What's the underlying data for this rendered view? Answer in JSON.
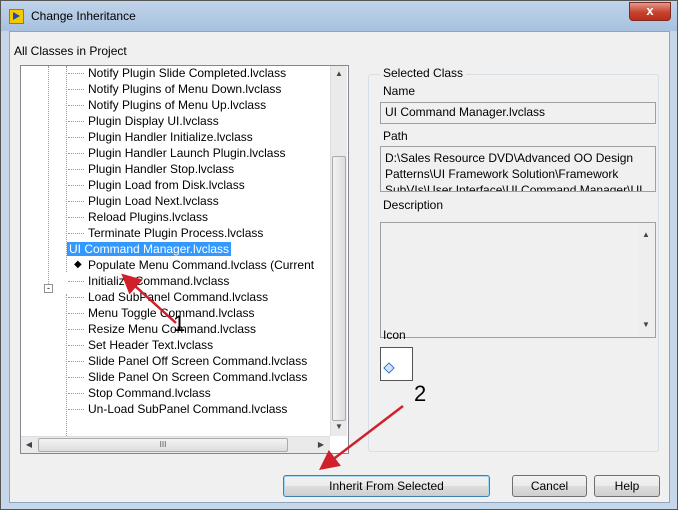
{
  "window": {
    "title": "Change Inheritance",
    "close_label": "x"
  },
  "tree": {
    "label": "All Classes in Project",
    "items": [
      "Notify Plugin Slide Completed.lvclass",
      "Notify Plugins of Menu Down.lvclass",
      "Notify Plugins of Menu Up.lvclass",
      "Plugin Display UI.lvclass",
      "Plugin Handler Initialize.lvclass",
      "Plugin Handler Launch Plugin.lvclass",
      "Plugin Handler Stop.lvclass",
      "Plugin Load from Disk.lvclass",
      "Plugin Load Next.lvclass",
      "Reload Plugins.lvclass",
      "Terminate Plugin Process.lvclass"
    ],
    "selected_parent": "UI Command Manager.lvclass",
    "current_item": "Populate Menu Command.lvclass (Current",
    "children": [
      "Initialize Command.lvclass",
      "Load SubPanel Command.lvclass",
      "Menu Toggle Command.lvclass",
      "Resize Menu Command.lvclass",
      "Set Header Text.lvclass",
      "Slide Panel Off Screen Command.lvclass",
      "Slide Panel On Screen Command.lvclass",
      "Stop Command.lvclass",
      "Un-Load SubPanel Command.lvclass"
    ],
    "hscroll_grip": "III",
    "marker": "◆"
  },
  "selected_class": {
    "group_title": "Selected Class",
    "name_label": "Name",
    "name_value": "UI Command Manager.lvclass",
    "path_label": "Path",
    "path_value": "D:\\Sales Resource DVD\\Advanced OO Design Patterns\\UI Framework Solution\\Framework SubVIs\\User Interface\\UI Command Manager\\UI",
    "description_label": "Description",
    "icon_label": "Icon"
  },
  "buttons": {
    "inherit": "Inherit From Selected",
    "cancel": "Cancel",
    "help": "Help"
  },
  "annotations": {
    "one": "1",
    "two": "2",
    "color": "#d0202a"
  },
  "colors": {
    "selection": "#3399ff",
    "titlebar": "#b3c9e3",
    "close": "#c8412d"
  }
}
